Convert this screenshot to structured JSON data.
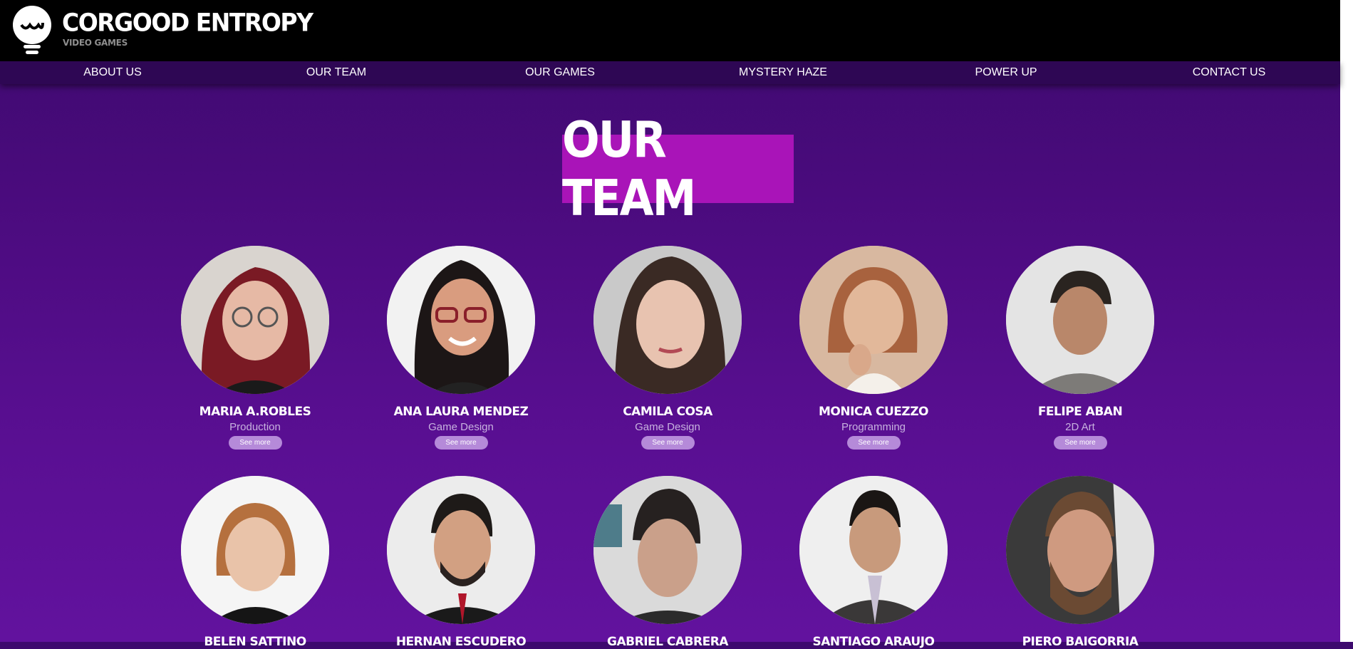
{
  "brand": {
    "name": "CORGOOD ENTROPY",
    "subtitle": "VIDEO GAMES"
  },
  "nav": [
    "ABOUT US",
    "OUR TEAM",
    "OUR GAMES",
    "MYSTERY HAZE",
    "POWER UP",
    "CONTACT US"
  ],
  "section_title": "OUR TEAM",
  "team": [
    {
      "name": "MARIA A.ROBLES",
      "role": "Production",
      "cta": "See more"
    },
    {
      "name": "ANA LAURA MENDEZ",
      "role": "Game Design",
      "cta": "See more"
    },
    {
      "name": "CAMILA COSA",
      "role": "Game Design",
      "cta": "See more"
    },
    {
      "name": "MONICA CUEZZO",
      "role": "Programming",
      "cta": "See more"
    },
    {
      "name": "FELIPE ABAN",
      "role": "2D Art",
      "cta": "See more"
    }
  ],
  "team_row2": [
    {
      "name": "BELEN SATTINO"
    },
    {
      "name": "HERNAN ESCUDERO"
    },
    {
      "name": "GABRIEL CABRERA"
    },
    {
      "name": "SANTIAGO ARAUJO"
    },
    {
      "name": "PIERO BAIGORRIA"
    }
  ],
  "colors": {
    "title_bg": "#a914b8",
    "button_bg": "#b58ad9",
    "header_bg": "#000000",
    "nav_bg": "#2e0754"
  }
}
